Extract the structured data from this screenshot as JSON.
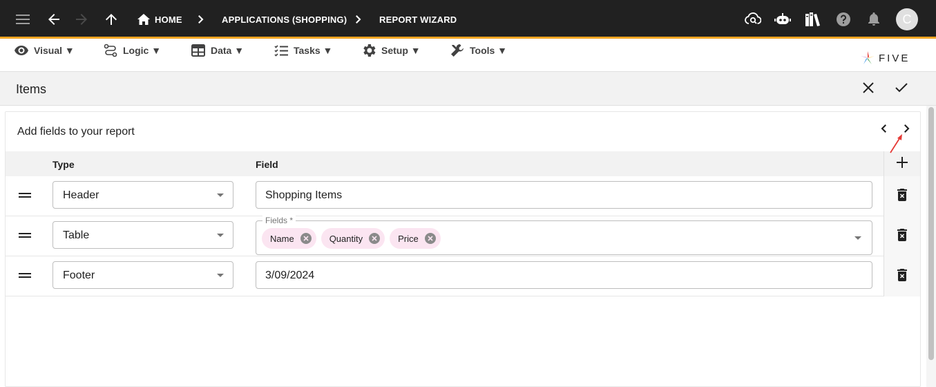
{
  "topbar": {
    "breadcrumbs": [
      {
        "label": "HOME"
      },
      {
        "label": "APPLICATIONS (SHOPPING)"
      },
      {
        "label": "REPORT WIZARD"
      }
    ],
    "avatar_initial": "C",
    "icons": [
      "menu-icon",
      "back-arrow-icon",
      "forward-arrow-icon",
      "up-arrow-icon",
      "home-icon",
      "cloud-search-icon",
      "bot-icon",
      "library-books-icon",
      "help-icon",
      "bell-icon"
    ],
    "accent_color": "#f5a623",
    "bar_color": "#212121"
  },
  "menubar": {
    "items": [
      {
        "label": "Visual ▼",
        "icon": "eye-icon"
      },
      {
        "label": "Logic ▼",
        "icon": "logic-flow-icon"
      },
      {
        "label": "Data ▼",
        "icon": "table-icon"
      },
      {
        "label": "Tasks ▼",
        "icon": "checklist-icon"
      },
      {
        "label": "Setup ▼",
        "icon": "gear-icon"
      },
      {
        "label": "Tools ▼",
        "icon": "tools-icon"
      }
    ],
    "logo_text": "FIVE"
  },
  "page": {
    "title": "Items",
    "actions": [
      "close-icon",
      "check-icon"
    ]
  },
  "wizard": {
    "title": "Add fields to your report",
    "columns": {
      "type": "Type",
      "field": "Field"
    },
    "rows": [
      {
        "type": "Header",
        "field": "Shopping Items"
      },
      {
        "type": "Table",
        "fields_label": "Fields *",
        "chips": [
          "Name",
          "Quantity",
          "Price"
        ]
      },
      {
        "type": "Footer",
        "field": "3/09/2024"
      }
    ],
    "chip_color": "#fbe5f1"
  }
}
